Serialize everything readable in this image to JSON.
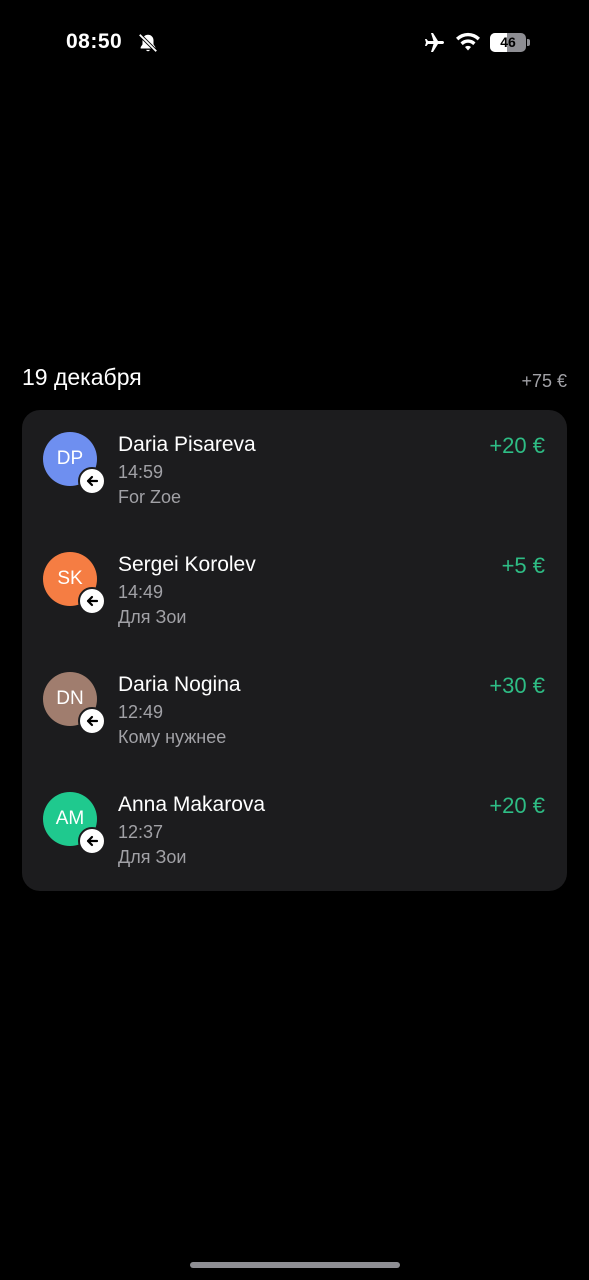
{
  "status_bar": {
    "time": "08:50",
    "battery_level": "46",
    "battery_fraction": 0.46,
    "icons": [
      "bell-slash-icon",
      "airplane-icon",
      "wifi-icon",
      "battery-icon"
    ]
  },
  "date_group": {
    "title": "19 декабря",
    "total": "+75 €"
  },
  "transactions": [
    {
      "initials": "DP",
      "name": "Daria Pisareva",
      "time": "14:59",
      "comment": "For Zoe",
      "amount": "+20 €",
      "avatar_color": "#6e8ff0"
    },
    {
      "initials": "SK",
      "name": "Sergei Korolev",
      "time": "14:49",
      "comment": "Для Зои",
      "amount": "+5 €",
      "avatar_color": "#f57d43"
    },
    {
      "initials": "DN",
      "name": "Daria Nogina",
      "time": "12:49",
      "comment": "Кому нужнее",
      "amount": "+30 €",
      "avatar_color": "#a07d6e"
    },
    {
      "initials": "AM",
      "name": "Anna Makarova",
      "time": "12:37",
      "comment": "Для Зои",
      "amount": "+20 €",
      "avatar_color": "#1fc98e"
    }
  ],
  "colors": {
    "background": "#000000",
    "card": "#1c1c1e",
    "positive_amount": "#2ebd85",
    "secondary_text": "#a1a1a6"
  }
}
